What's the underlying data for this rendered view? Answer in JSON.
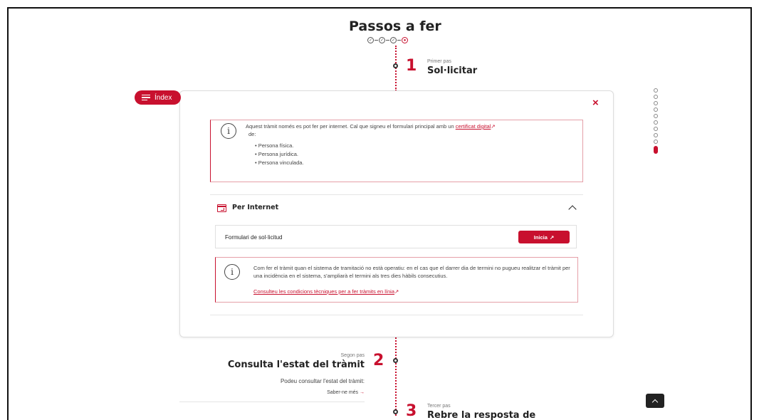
{
  "header": {
    "title": "Passos a fer",
    "step_marks": [
      "✓",
      "✓",
      "✓",
      "●"
    ]
  },
  "index_button": {
    "label": "Índex"
  },
  "step1": {
    "number": "1",
    "overline": "Primer pas",
    "title": "Sol·licitar"
  },
  "panel": {
    "close_label": "×",
    "info1": {
      "text_before": "Aquest tràmit només es pot fer per internet. Cal que signeu el formulari principal amb un ",
      "link": "certificat digital",
      "link_icon": "↗",
      "text_after": "de:",
      "items": [
        "Persona física.",
        "Persona jurídica.",
        "Persona vinculada."
      ]
    },
    "section": {
      "title": "Per Internet",
      "form_label": "Formulari de sol·licitud",
      "button_label": "Inicia",
      "button_icon": "↗"
    },
    "info2": {
      "text": "Com fer el tràmit quan el sistema de tramitació no està operatiu: en el cas que el darrer dia de termini no pugueu realitzar el tràmit per una incidència en el sistema, s'ampliarà el termini als tres dies hàbils consecutius.",
      "link": "Consulteu les condicions tècniques per a fer tràmits en línia",
      "link_icon": "↗"
    }
  },
  "progress_dots": {
    "total": 10,
    "active_index": 9
  },
  "step2": {
    "number": "2",
    "overline": "Segon pas",
    "title": "Consulta l'estat del tràmit",
    "text": "Podeu consultar l'estat del tràmit:",
    "link": "Saber-ne més",
    "link_arrow": "→"
  },
  "step3": {
    "number": "3",
    "overline": "Tercer pas",
    "title": "Rebre la resposta de"
  },
  "colors": {
    "accent": "#c8102e",
    "text": "#222222",
    "border": "#e0e0e0"
  }
}
